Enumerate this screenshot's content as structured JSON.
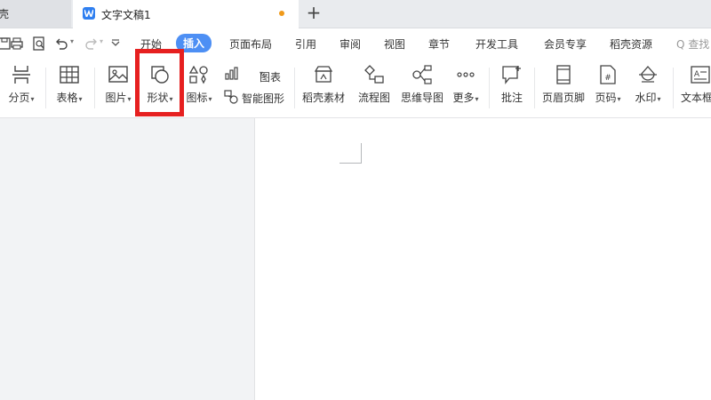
{
  "tabs": {
    "previous": "壳",
    "active_title": "文字文稿1",
    "new_tab": "+"
  },
  "menu": {
    "items": [
      "开始",
      "插入",
      "页面布局",
      "引用",
      "审阅",
      "视图",
      "章节",
      "开发工具",
      "会员专享",
      "稻壳资源"
    ],
    "active": "插入",
    "search": "Q 查找"
  },
  "ribbon": {
    "page_break": "分页",
    "table": "表格",
    "picture": "图片",
    "shape": "形状",
    "icon": "图标",
    "chart": "图表",
    "smart_shape": "智能图形",
    "daoke_material": "稻壳素材",
    "flowchart": "流程图",
    "mindmap": "思维导图",
    "more": "更多",
    "comment": "批注",
    "header_footer": "页眉页脚",
    "page_number": "页码",
    "watermark": "水印",
    "textbox": "文本框"
  },
  "highlight_color": "#e62020",
  "accent_color": "#4d8ff4"
}
